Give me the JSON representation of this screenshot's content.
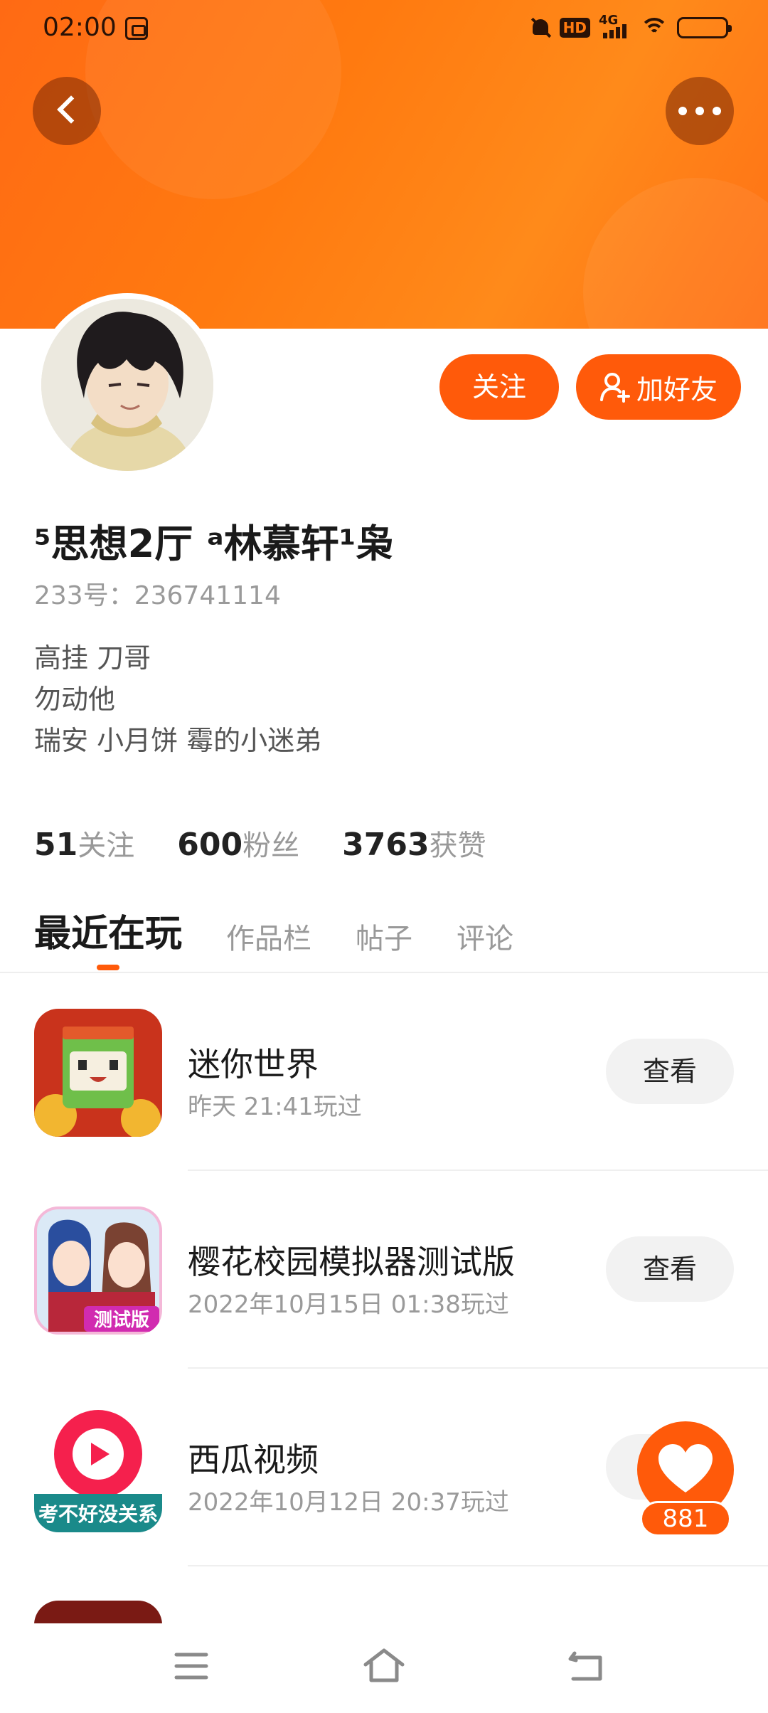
{
  "status_bar": {
    "time": "02:00",
    "hd": "HD",
    "network": "4G",
    "battery_level": 0.3
  },
  "header": {
    "back_icon": "chevron-left-icon",
    "more_icon": "more-horizontal-icon",
    "accent_color": "#ff5a0a"
  },
  "actions": {
    "follow_label": "关注",
    "add_friend_label": "加好友"
  },
  "profile": {
    "name": "⁵思想2厅 ᵃ林慕轩¹枭",
    "uid": "233号：236741114",
    "bio_lines": [
      "高挂 刀哥",
      "勿动他",
      "瑞安 小月饼 霉的小迷弟"
    ]
  },
  "stats": [
    {
      "num": "51",
      "label": "关注"
    },
    {
      "num": "600",
      "label": "粉丝"
    },
    {
      "num": "3763",
      "label": "获赞"
    }
  ],
  "tabs": [
    {
      "label": "最近在玩",
      "active": true
    },
    {
      "label": "作品栏",
      "active": false
    },
    {
      "label": "帖子",
      "active": false
    },
    {
      "label": "评论",
      "active": false
    }
  ],
  "games": [
    {
      "title": "迷你世界",
      "time": "昨天 21:41玩过",
      "button": "查看",
      "icon": "mini-world-game-icon"
    },
    {
      "title": "樱花校园模拟器测试版",
      "time": "2022年10月15日 01:38玩过",
      "button": "查看",
      "icon": "sakura-school-game-icon",
      "badge": "测试版"
    },
    {
      "title": "西瓜视频",
      "time": "2022年10月12日 20:37玩过",
      "button": "查看",
      "icon": "xigua-video-app-icon",
      "banner": "考不好没关系"
    }
  ],
  "like": {
    "count": "881",
    "icon": "heart-icon"
  },
  "navbar": {
    "menu_icon": "menu-icon",
    "home_icon": "home-icon",
    "back_icon": "back-icon"
  }
}
